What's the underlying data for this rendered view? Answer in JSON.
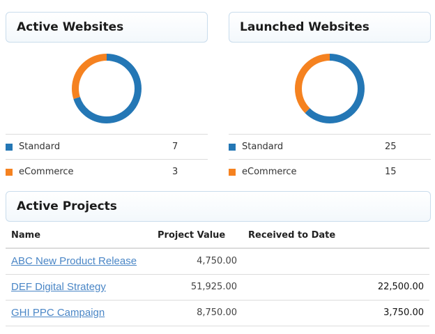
{
  "active_websites": {
    "title": "Active Websites",
    "items": [
      {
        "label": "Standard",
        "count": "7",
        "value": 7,
        "color": "#2477b5"
      },
      {
        "label": "eCommerce",
        "count": "3",
        "value": 3,
        "color": "#f58220"
      }
    ]
  },
  "launched_websites": {
    "title": "Launched Websites",
    "items": [
      {
        "label": "Standard",
        "count": "25",
        "value": 25,
        "color": "#2477b5"
      },
      {
        "label": "eCommerce",
        "count": "15",
        "value": 15,
        "color": "#f58220"
      }
    ]
  },
  "active_projects": {
    "title": "Active Projects",
    "columns": {
      "name": "Name",
      "value": "Project Value",
      "received": "Received to Date"
    },
    "rows": [
      {
        "name": "ABC New Product Release",
        "value": "4,750.00",
        "received": ""
      },
      {
        "name": "DEF Digital Strategy",
        "value": "51,925.00",
        "received": "22,500.00"
      },
      {
        "name": "GHI PPC Campaign",
        "value": "8,750.00",
        "received": "3,750.00"
      }
    ]
  }
}
